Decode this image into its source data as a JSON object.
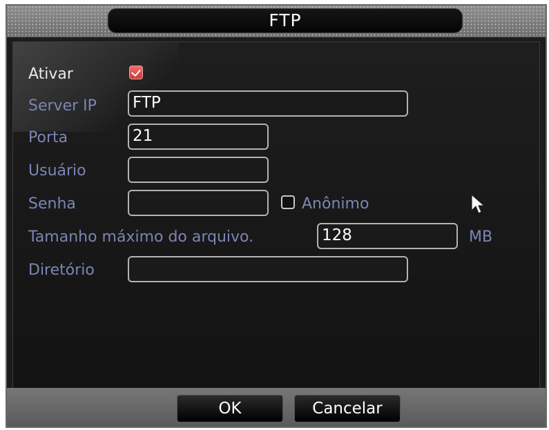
{
  "dialog": {
    "title": "FTP"
  },
  "form": {
    "enable": {
      "label": "Ativar",
      "checked": true
    },
    "server_ip": {
      "label": "Server IP",
      "value": "FTP"
    },
    "port": {
      "label": "Porta",
      "value": "21"
    },
    "user": {
      "label": "Usuário",
      "value": ""
    },
    "password": {
      "label": "Senha",
      "value": ""
    },
    "anonymous": {
      "label": "Anônimo",
      "checked": false
    },
    "max_file_size": {
      "label": "Tamanho máximo do arquivo.",
      "value": "128",
      "unit": "MB"
    },
    "directory": {
      "label": "Diretório",
      "value": ""
    }
  },
  "buttons": {
    "ok": "OK",
    "cancel": "Cancelar"
  },
  "colors": {
    "label": "#7d85b6",
    "check_accent": "#e05555"
  }
}
